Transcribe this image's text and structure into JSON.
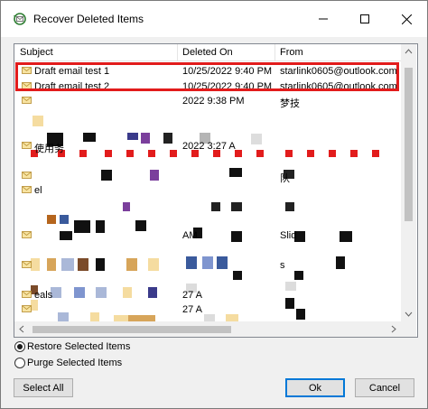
{
  "window": {
    "title": "Recover Deleted Items"
  },
  "columns": {
    "subject": "Subject",
    "deleted_on": "Deleted On",
    "from": "From"
  },
  "rows": [
    {
      "subject": "Draft email test 1",
      "deleted_on": "10/25/2022 9:40 PM",
      "from": "starlink0605@outlook.com"
    },
    {
      "subject": "Draft email test 2",
      "deleted_on": "10/25/2022 9:40 PM",
      "from": "starlink0605@outlook.com"
    },
    {
      "subject": "",
      "deleted_on": "2022 9:38 PM",
      "from": "梦技"
    },
    {
      "subject": "",
      "deleted_on": "",
      "from": ""
    },
    {
      "subject": "",
      "deleted_on": "",
      "from": ""
    },
    {
      "subject": "使用务",
      "deleted_on": "2022 3:27 A",
      "from": ""
    },
    {
      "subject": "",
      "deleted_on": "",
      "from": ""
    },
    {
      "subject": "",
      "deleted_on": "",
      "from": "队"
    },
    {
      "subject": "el",
      "deleted_on": "",
      "from": ""
    },
    {
      "subject": "",
      "deleted_on": "",
      "from": ""
    },
    {
      "subject": "",
      "deleted_on": "",
      "from": ""
    },
    {
      "subject": "",
      "deleted_on": "AM",
      "from": "Slid"
    },
    {
      "subject": "",
      "deleted_on": "",
      "from": ""
    },
    {
      "subject": "",
      "deleted_on": "",
      "from": "s"
    },
    {
      "subject": "",
      "deleted_on": "",
      "from": ""
    },
    {
      "subject": "eals",
      "deleted_on": "27 A",
      "from": ""
    },
    {
      "subject": "",
      "deleted_on": "27 A",
      "from": ""
    }
  ],
  "options": {
    "restore_label": "Restore Selected Items",
    "purge_label": "Purge Selected Items",
    "selected": "restore"
  },
  "buttons": {
    "select_all": "Select All",
    "ok": "Ok",
    "cancel": "Cancel"
  },
  "colors": {
    "highlight": "#e21c1c",
    "accent": "#0078d7"
  }
}
